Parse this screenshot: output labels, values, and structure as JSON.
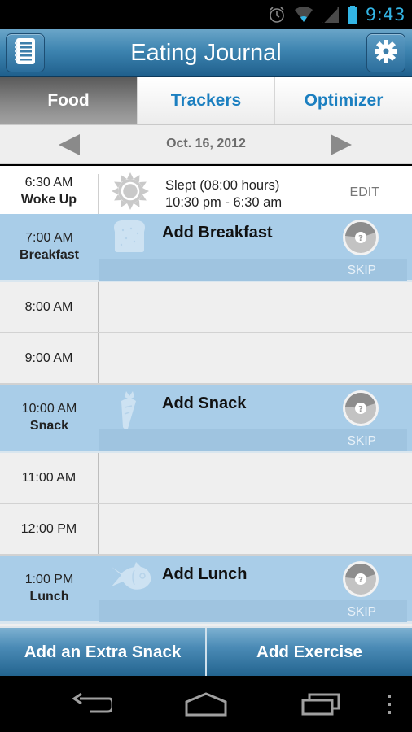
{
  "status_bar": {
    "icons": [
      "alarm-icon",
      "wifi-icon",
      "signal-icon",
      "battery-icon"
    ],
    "time": "9:43",
    "clock_color": "#33b5e5"
  },
  "header": {
    "title": "Eating Journal",
    "left_button_icon": "notebook-icon",
    "right_button_icon": "gear-icon"
  },
  "tabs": [
    {
      "label": "Food",
      "active": true
    },
    {
      "label": "Trackers",
      "active": false
    },
    {
      "label": "Optimizer",
      "active": false
    }
  ],
  "date_nav": {
    "date": "Oct. 16, 2012",
    "prev_icon": "triangle-left-icon",
    "next_icon": "triangle-right-icon"
  },
  "timeline": {
    "wake": {
      "time": "6:30 AM",
      "label": "Woke Up",
      "icon": "sun-moon-icon",
      "line1": "Slept (08:00 hours)",
      "line2": "10:30 pm - 6:30 am",
      "edit_label": "EDIT"
    },
    "meals": [
      {
        "time": "7:00 AM",
        "label": "Breakfast",
        "action": "Add Breakfast",
        "icon": "bread-icon",
        "skip": "SKIP",
        "score_icon": "question-score-icon"
      },
      {
        "time": "10:00 AM",
        "label": "Snack",
        "action": "Add Snack",
        "icon": "carrot-icon",
        "skip": "SKIP",
        "score_icon": "question-score-icon"
      },
      {
        "time": "1:00 PM",
        "label": "Lunch",
        "action": "Add Lunch",
        "icon": "fish-icon",
        "skip": "SKIP",
        "score_icon": "question-score-icon"
      }
    ],
    "empty_slots": [
      "8:00 AM",
      "9:00 AM",
      "11:00 AM",
      "12:00 PM"
    ]
  },
  "bottom_buttons": {
    "extra_snack": "Add an Extra Snack",
    "exercise": "Add Exercise"
  },
  "nav_bar": {
    "icons": [
      "back-icon",
      "home-icon",
      "recent-apps-icon",
      "overflow-menu-icon"
    ]
  },
  "colors": {
    "accent_blue": "#1b7fc0",
    "meal_row_bg": "#a9cde8",
    "header_blue": "#3d84b0"
  }
}
